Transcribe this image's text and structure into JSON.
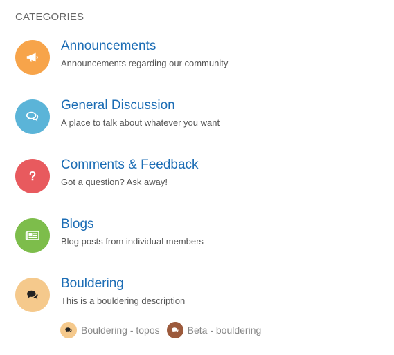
{
  "section_title": "CATEGORIES",
  "colors": {
    "link": "#1c6db5",
    "announcements": "#f7a44a",
    "general": "#5bb4d8",
    "comments": "#e85a5e",
    "blogs": "#7dbd4b",
    "bouldering": "#f5c98c",
    "sub_topos": "#f5c98c",
    "sub_beta": "#9c5a3c"
  },
  "categories": [
    {
      "name": "Announcements",
      "description": "Announcements regarding our community",
      "icon": "bullhorn-icon"
    },
    {
      "name": "General Discussion",
      "description": "A place to talk about whatever you want",
      "icon": "comments-icon"
    },
    {
      "name": "Comments & Feedback",
      "description": "Got a question? Ask away!",
      "icon": "question-icon"
    },
    {
      "name": "Blogs",
      "description": "Blog posts from individual members",
      "icon": "newspaper-icon"
    },
    {
      "name": "Bouldering",
      "description": "This is a bouldering description",
      "icon": "comments-icon",
      "subcategories": [
        {
          "name": "Bouldering - topos",
          "icon": "comments-icon"
        },
        {
          "name": "Beta - bouldering",
          "icon": "comments-icon"
        }
      ]
    }
  ]
}
